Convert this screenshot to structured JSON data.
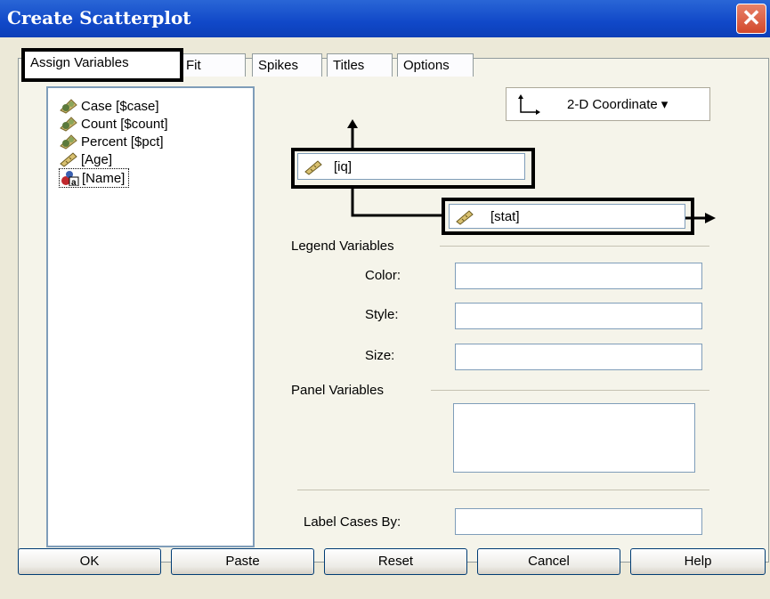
{
  "window": {
    "title": "Create Scatterplot",
    "close_symbol": "✕"
  },
  "tabs": [
    "Assign Variables",
    "Fit",
    "Spikes",
    "Titles",
    "Options"
  ],
  "variables": [
    {
      "label": "Case [$case]",
      "icon": "scale-icon"
    },
    {
      "label": "Count [$count]",
      "icon": "scale-icon"
    },
    {
      "label": "Percent [$pct]",
      "icon": "scale-icon"
    },
    {
      "label": "[Age]",
      "icon": "ruler-icon"
    },
    {
      "label": "[Name]",
      "icon": "nominal-icon",
      "selected": true
    }
  ],
  "coordinate": {
    "label": "2-D Coordinate",
    "arrow": "▾"
  },
  "y_axis": {
    "value": "[iq]"
  },
  "x_axis": {
    "value": "[stat]"
  },
  "legend": {
    "heading": "Legend Variables",
    "color_label": "Color:",
    "style_label": "Style:",
    "size_label": "Size:"
  },
  "panel": {
    "heading": "Panel Variables"
  },
  "label_cases": {
    "label": "Label Cases By:"
  },
  "buttons": {
    "ok": "OK",
    "paste": "Paste",
    "reset": "Reset",
    "cancel": "Cancel",
    "help": "Help"
  },
  "colors": {
    "titlebar": "#1048c8",
    "dialog": "#ece9d8",
    "highlight": "#000000"
  }
}
